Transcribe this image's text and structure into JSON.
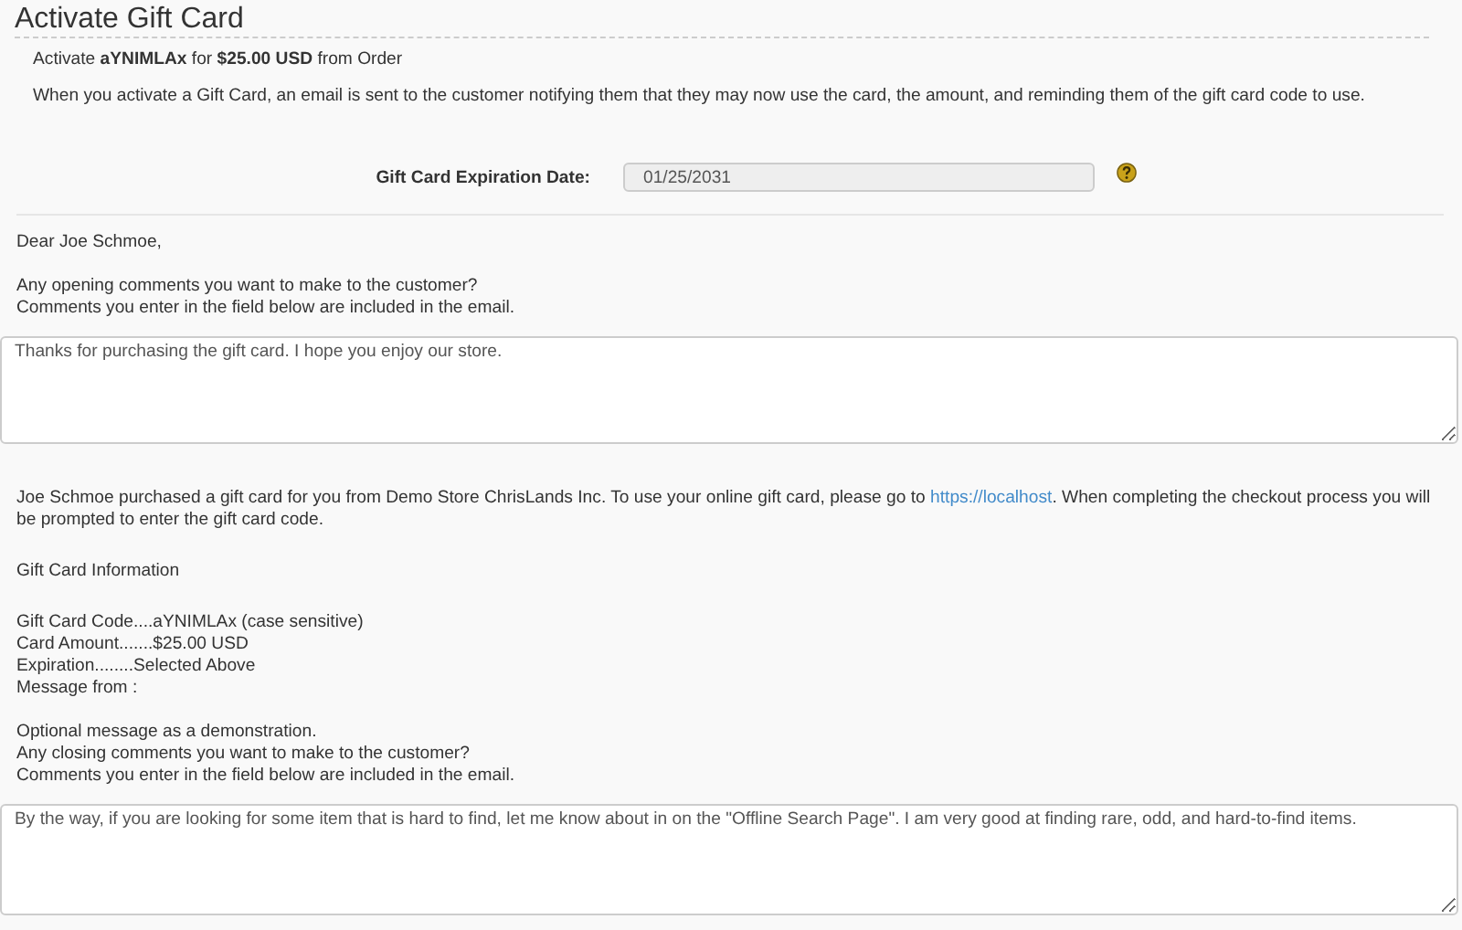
{
  "title": "Activate Gift Card",
  "summary": "Activate **aYNIMLAx** for **$25.00 USD** from Order",
  "explanation": "When you activate a Gift Card, an email is sent to the customer notifying them that they may now use the card, the amount, and reminding them of the gift card code to use.",
  "expiration": {
    "label": "Gift Card Expiration Date:",
    "value": "01/25/2031",
    "readonly": true
  },
  "greeting": "Dear Joe Schmoe,",
  "opening_prompt": [
    "Any opening comments you want to make to the customer?",
    "Comments you enter in the field below are included in the email."
  ],
  "opening_comment": "Thanks for purchasing the gift card. I hope you enjoy our store.",
  "body": {
    "before": "Joe Schmoe purchased a gift card for you from Demo Store ChrisLands Inc. To use your online gift card, please go to ",
    "link": "https://localhost",
    "after": ". When completing the checkout process you will be prompted to enter the gift card code."
  },
  "info_heading": "Gift Card Information",
  "info_lines": [
    "Gift Card Code....aYNIMLAx (case sensitive)",
    "Card Amount.......$25.00 USD",
    "Expiration........Selected Above",
    "Message from :"
  ],
  "closing_lines": [
    "Optional message as a demonstration.",
    "Any closing comments you want to make to the customer?",
    "Comments you enter in the field below are included in the email."
  ],
  "closing_comment": "By the way, if you are looking for some item that is hard to find, let me know about in on the \"Offline Search Page\". I am very good at finding rare, odd, and hard-to-find items."
}
